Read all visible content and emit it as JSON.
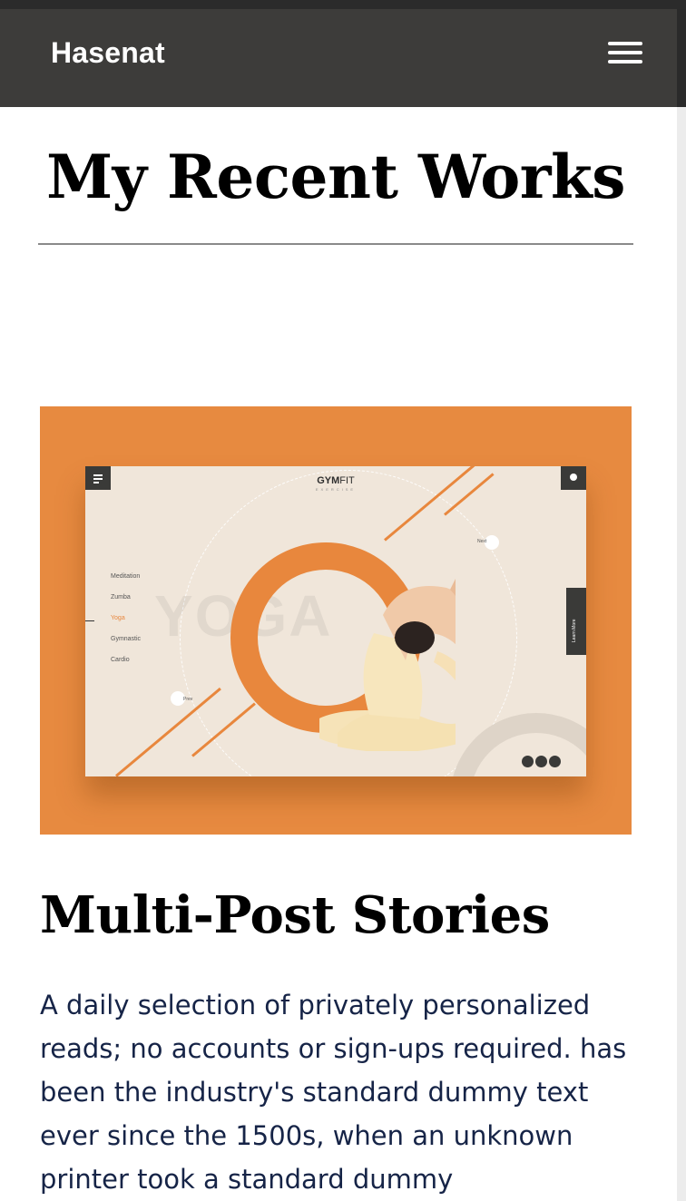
{
  "navbar": {
    "brand": "Hasenat",
    "menu_icon": "hamburger-menu-icon"
  },
  "section": {
    "title": "My Recent Works"
  },
  "work": {
    "image": {
      "brand": "GYM",
      "brand_suffix": "FIT",
      "brand_sub": "EXERCISE",
      "big_word": "YOGA",
      "menu_items": [
        "Meditation",
        "Zumba",
        "Yoga",
        "Gymnastic",
        "Cardio"
      ],
      "active_item": "Yoga",
      "next_label": "Next",
      "prev_label": "Prev",
      "learn_more": "Learn More",
      "accent_color": "#e8873d"
    },
    "title": "Multi-Post Stories",
    "description": "A daily selection of privately personalized reads; no accounts or sign-ups required. has been the industry's standard dummy text ever since the 1500s, when an unknown printer took a standard dummy"
  }
}
